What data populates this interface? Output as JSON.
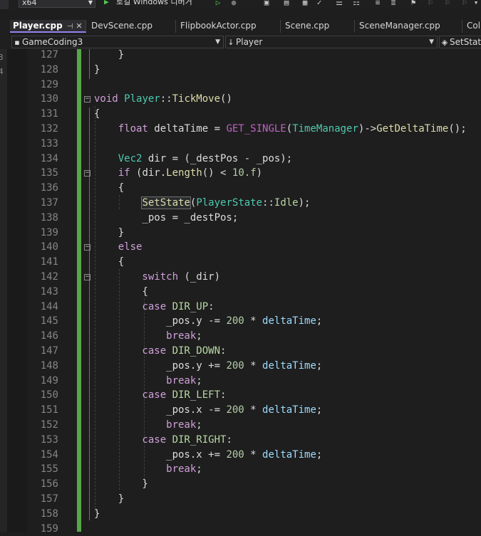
{
  "toolbar": {
    "platform": "x64",
    "run_target": "로컬 Windows 디버거"
  },
  "tabs": [
    {
      "label": "Player.cpp",
      "active": true
    },
    {
      "label": "DevScene.cpp"
    },
    {
      "label": "FlipbookActor.cpp"
    },
    {
      "label": "Scene.cpp"
    },
    {
      "label": "SceneManager.cpp"
    },
    {
      "label": "Coll"
    }
  ],
  "nav": {
    "project": "GameCoding3",
    "scope": "Player",
    "member": "SetStat"
  },
  "editor": {
    "line_numbers": [
      "127",
      "128",
      "129",
      "130",
      "131",
      "132",
      "133",
      "134",
      "135",
      "136",
      "137",
      "138",
      "139",
      "140",
      "141",
      "142",
      "143",
      "144",
      "145",
      "146",
      "147",
      "148",
      "149",
      "150",
      "151",
      "152",
      "153",
      "154",
      "155",
      "156",
      "157",
      "158",
      "159"
    ],
    "code": [
      [
        {
          "t": "    }",
          "c": "pl"
        }
      ],
      [
        {
          "t": "}",
          "c": "pl"
        }
      ],
      [],
      [
        {
          "t": "void ",
          "c": "kw"
        },
        {
          "t": "Player",
          "c": "ty"
        },
        {
          "t": "::",
          "c": "pl"
        },
        {
          "t": "TickMove",
          "c": "fn"
        },
        {
          "t": "()",
          "c": "pl"
        }
      ],
      [
        {
          "t": "{",
          "c": "pl"
        }
      ],
      [
        {
          "t": "    float ",
          "c": "kw"
        },
        {
          "t": "deltaTime = ",
          "c": "pl"
        },
        {
          "t": "GET_SINGLE",
          "c": "mac"
        },
        {
          "t": "(",
          "c": "pl"
        },
        {
          "t": "TimeManager",
          "c": "ty"
        },
        {
          "t": ")->",
          "c": "pl"
        },
        {
          "t": "GetDeltaTime",
          "c": "fn"
        },
        {
          "t": "();",
          "c": "pl"
        }
      ],
      [],
      [
        {
          "t": "    ",
          "c": "pl"
        },
        {
          "t": "Vec2",
          "c": "ty"
        },
        {
          "t": " dir = (_destPos - _pos);",
          "c": "pl"
        }
      ],
      [
        {
          "t": "    if ",
          "c": "kw"
        },
        {
          "t": "(dir.",
          "c": "pl"
        },
        {
          "t": "Length",
          "c": "fn"
        },
        {
          "t": "() < ",
          "c": "pl"
        },
        {
          "t": "10.f",
          "c": "num"
        },
        {
          "t": ")",
          "c": "pl"
        }
      ],
      [
        {
          "t": "    {",
          "c": "pl"
        }
      ],
      [
        {
          "t": "        ",
          "c": "pl"
        },
        {
          "t": "SetState",
          "c": "fn hl"
        },
        {
          "t": "(",
          "c": "pl"
        },
        {
          "t": "PlayerState",
          "c": "ty"
        },
        {
          "t": "::",
          "c": "pl"
        },
        {
          "t": "Idle",
          "c": "en"
        },
        {
          "t": ");",
          "c": "pl"
        }
      ],
      [
        {
          "t": "        _pos = _destPos;",
          "c": "pl"
        }
      ],
      [
        {
          "t": "    }",
          "c": "pl"
        }
      ],
      [
        {
          "t": "    else",
          "c": "kw"
        }
      ],
      [
        {
          "t": "    {",
          "c": "pl"
        }
      ],
      [
        {
          "t": "        switch ",
          "c": "kw"
        },
        {
          "t": "(_dir)",
          "c": "pl"
        }
      ],
      [
        {
          "t": "        {",
          "c": "pl"
        }
      ],
      [
        {
          "t": "        case ",
          "c": "kw"
        },
        {
          "t": "DIR_UP",
          "c": "en"
        },
        {
          "t": ":",
          "c": "pl"
        }
      ],
      [
        {
          "t": "            _pos.y -= ",
          "c": "pl"
        },
        {
          "t": "200",
          "c": "num"
        },
        {
          "t": " * ",
          "c": "pl"
        },
        {
          "t": "deltaTime",
          "c": "va"
        },
        {
          "t": ";",
          "c": "pl"
        }
      ],
      [
        {
          "t": "            break",
          "c": "kw"
        },
        {
          "t": ";",
          "c": "pl"
        }
      ],
      [
        {
          "t": "        case ",
          "c": "kw"
        },
        {
          "t": "DIR_DOWN",
          "c": "en"
        },
        {
          "t": ":",
          "c": "pl"
        }
      ],
      [
        {
          "t": "            _pos.y += ",
          "c": "pl"
        },
        {
          "t": "200",
          "c": "num"
        },
        {
          "t": " * ",
          "c": "pl"
        },
        {
          "t": "deltaTime",
          "c": "va"
        },
        {
          "t": ";",
          "c": "pl"
        }
      ],
      [
        {
          "t": "            break",
          "c": "kw"
        },
        {
          "t": ";",
          "c": "pl"
        }
      ],
      [
        {
          "t": "        case ",
          "c": "kw"
        },
        {
          "t": "DIR_LEFT",
          "c": "en"
        },
        {
          "t": ":",
          "c": "pl"
        }
      ],
      [
        {
          "t": "            _pos.x -= ",
          "c": "pl"
        },
        {
          "t": "200",
          "c": "num"
        },
        {
          "t": " * ",
          "c": "pl"
        },
        {
          "t": "deltaTime",
          "c": "va"
        },
        {
          "t": ";",
          "c": "pl"
        }
      ],
      [
        {
          "t": "            break",
          "c": "kw"
        },
        {
          "t": ";",
          "c": "pl"
        }
      ],
      [
        {
          "t": "        case ",
          "c": "kw"
        },
        {
          "t": "DIR_RIGHT",
          "c": "en"
        },
        {
          "t": ":",
          "c": "pl"
        }
      ],
      [
        {
          "t": "            _pos.x += ",
          "c": "pl"
        },
        {
          "t": "200",
          "c": "num"
        },
        {
          "t": " * ",
          "c": "pl"
        },
        {
          "t": "deltaTime",
          "c": "va"
        },
        {
          "t": ";",
          "c": "pl"
        }
      ],
      [
        {
          "t": "            break",
          "c": "kw"
        },
        {
          "t": ";",
          "c": "pl"
        }
      ],
      [
        {
          "t": "        }",
          "c": "pl"
        }
      ],
      [
        {
          "t": "    }",
          "c": "pl"
        }
      ],
      [
        {
          "t": "}",
          "c": "pl"
        }
      ],
      []
    ],
    "fold_lines": [
      3,
      8,
      13,
      15
    ]
  }
}
